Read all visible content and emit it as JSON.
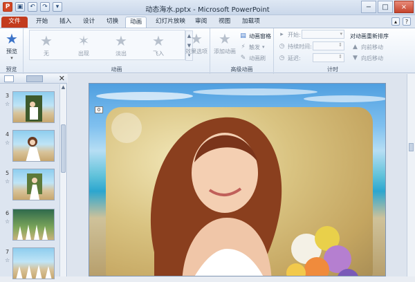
{
  "window": {
    "title": "动态海水.pptx - Microsoft PowerPoint",
    "controls": [
      "−",
      "□",
      "×"
    ]
  },
  "tabs": [
    {
      "label": "文件"
    },
    {
      "label": "开始"
    },
    {
      "label": "插入"
    },
    {
      "label": "设计"
    },
    {
      "label": "切换"
    },
    {
      "label": "动画"
    },
    {
      "label": "幻灯片放映"
    },
    {
      "label": "审阅"
    },
    {
      "label": "视图"
    },
    {
      "label": "加载项"
    }
  ],
  "ribbon": {
    "preview": {
      "button": "预览",
      "group": "预览"
    },
    "animation": {
      "group": "动画",
      "gallery": [
        {
          "label": "无"
        },
        {
          "label": "出现"
        },
        {
          "label": "淡出"
        },
        {
          "label": "飞入"
        }
      ],
      "effect_options": "效果选项"
    },
    "advanced": {
      "group": "高级动画",
      "add_animation": "添加动画",
      "pane": "动画窗格",
      "trigger": "触发",
      "painter": "动画刷"
    },
    "timing": {
      "group": "计时",
      "start": "开始:",
      "duration": "持续时间:",
      "delay": "延迟:",
      "reorder_title": "对动画重新排序",
      "move_earlier": "向前移动",
      "move_later": "向后移动"
    }
  },
  "thumbnails": [
    {
      "num": "3",
      "star": "☆"
    },
    {
      "num": "4",
      "star": "☆"
    },
    {
      "num": "5",
      "star": "☆"
    },
    {
      "num": "6",
      "star": "☆"
    },
    {
      "num": "7",
      "star": "☆"
    }
  ],
  "slide": {
    "badge": "0"
  }
}
